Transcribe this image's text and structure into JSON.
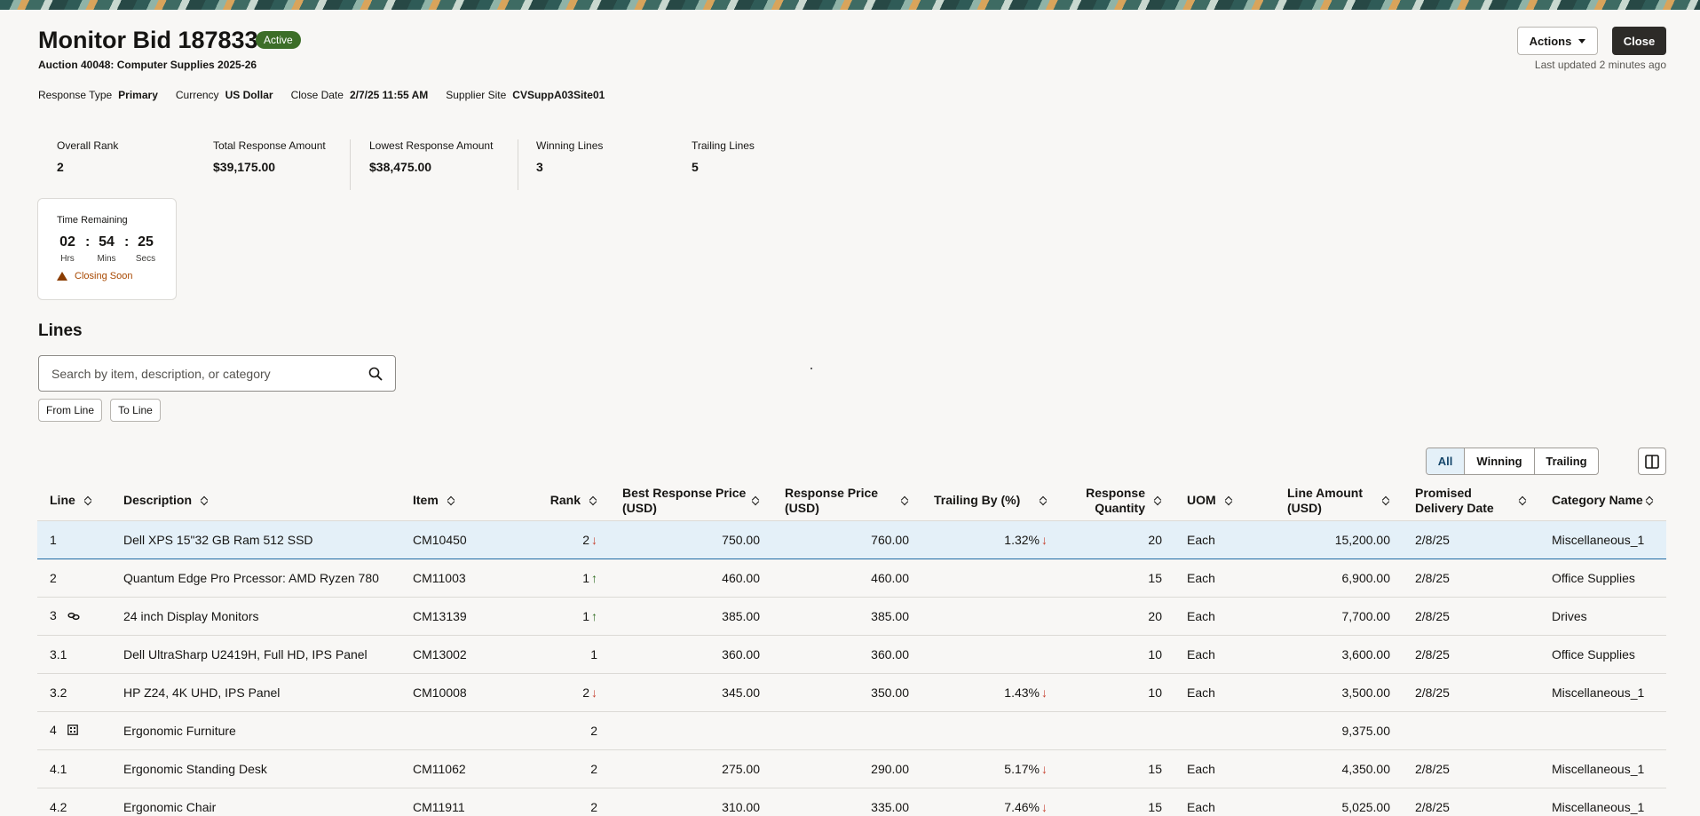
{
  "header": {
    "title": "Monitor Bid 187833",
    "status": "Active",
    "subtitle": "Auction 40048: Computer Supplies 2025-26",
    "actions_label": "Actions",
    "close_label": "Close",
    "last_updated": "Last updated 2 minutes ago"
  },
  "meta": [
    {
      "label": "Response Type",
      "value": "Primary"
    },
    {
      "label": "Currency",
      "value": "US Dollar"
    },
    {
      "label": "Close Date",
      "value": "2/7/25 11:55 AM"
    },
    {
      "label": "Supplier Site",
      "value": "CVSuppA03Site01"
    }
  ],
  "stats": {
    "overall_rank": {
      "label": "Overall Rank",
      "value": "2"
    },
    "total_response": {
      "label": "Total Response Amount",
      "value": "$39,175.00"
    },
    "lowest_response": {
      "label": "Lowest Response Amount",
      "value": "$38,475.00"
    },
    "winning_lines": {
      "label": "Winning Lines",
      "value": "3"
    },
    "trailing_lines": {
      "label": "Trailing Lines",
      "value": "5"
    }
  },
  "timer": {
    "title": "Time Remaining",
    "hrs": "02",
    "mins": "54",
    "secs": "25",
    "hrs_label": "Hrs",
    "mins_label": "Mins",
    "secs_label": "Secs",
    "warning": "Closing Soon",
    "warning_color": "#a84800"
  },
  "lines": {
    "heading": "Lines",
    "search_placeholder": "Search by item, description, or category",
    "from_line": "From Line",
    "to_line": "To Line",
    "filters": [
      "All",
      "Winning",
      "Trailing"
    ],
    "selected_filter": "All",
    "columns": {
      "line": "Line",
      "description": "Description",
      "item": "Item",
      "rank": "Rank",
      "best_price": "Best Response Price (USD)",
      "response_price": "Response Price (USD)",
      "trailing_by": "Trailing By (%)",
      "quantity": "Response Quantity",
      "uom": "UOM",
      "line_amount": "Line Amount (USD)",
      "delivery": "Promised Delivery Date",
      "category": "Category Name"
    },
    "rows": [
      {
        "line": "1",
        "icon": "",
        "description": "Dell XPS 15\"32 GB Ram 512 SSD",
        "item": "CM10450",
        "rank": "2",
        "trend": "down",
        "best": "750.00",
        "price": "760.00",
        "trailing": "1.32%",
        "qty": "20",
        "uom": "Each",
        "amount": "15,200.00",
        "date": "2/8/25",
        "category": "Miscellaneous_1",
        "selected": true
      },
      {
        "line": "2",
        "icon": "",
        "description": "Quantum Edge Pro Prcessor: AMD Ryzen 780",
        "item": "CM11003",
        "rank": "1",
        "trend": "up",
        "best": "460.00",
        "price": "460.00",
        "trailing": "",
        "qty": "15",
        "uom": "Each",
        "amount": "6,900.00",
        "date": "2/8/25",
        "category": "Office Supplies"
      },
      {
        "line": "3",
        "icon": "link-icon",
        "description": "24 inch Display Monitors",
        "item": "CM13139",
        "rank": "1",
        "trend": "up",
        "best": "385.00",
        "price": "385.00",
        "trailing": "",
        "qty": "20",
        "uom": "Each",
        "amount": "7,700.00",
        "date": "2/8/25",
        "category": "Drives"
      },
      {
        "line": "3.1",
        "icon": "",
        "description": "Dell UltraSharp U2419H, Full HD, IPS Panel",
        "item": "CM13002",
        "rank": "1",
        "trend": "",
        "best": "360.00",
        "price": "360.00",
        "trailing": "",
        "qty": "10",
        "uom": "Each",
        "amount": "3,600.00",
        "date": "2/8/25",
        "category": "Office Supplies"
      },
      {
        "line": "3.2",
        "icon": "",
        "description": "HP Z24, 4K UHD, IPS Panel",
        "item": "CM10008",
        "rank": "2",
        "trend": "down",
        "best": "345.00",
        "price": "350.00",
        "trailing": "1.43%",
        "qty": "10",
        "uom": "Each",
        "amount": "3,500.00",
        "date": "2/8/25",
        "category": "Miscellaneous_1"
      },
      {
        "line": "4",
        "icon": "group-icon",
        "description": "Ergonomic Furniture",
        "item": "",
        "rank": "2",
        "trend": "",
        "best": "",
        "price": "",
        "trailing": "",
        "qty": "",
        "uom": "",
        "amount": "9,375.00",
        "date": "",
        "category": ""
      },
      {
        "line": "4.1",
        "icon": "",
        "description": "Ergonomic Standing Desk",
        "item": "CM11062",
        "rank": "2",
        "trend": "",
        "best": "275.00",
        "price": "290.00",
        "trailing": "5.17%",
        "qty": "15",
        "uom": "Each",
        "amount": "4,350.00",
        "date": "2/8/25",
        "category": "Miscellaneous_1"
      },
      {
        "line": "4.2",
        "icon": "",
        "description": "Ergonomic Chair",
        "item": "CM11911",
        "rank": "2",
        "trend": "",
        "best": "310.00",
        "price": "335.00",
        "trailing": "7.46%",
        "qty": "15",
        "uom": "Each",
        "amount": "5,025.00",
        "date": "2/8/25",
        "category": "Miscellaneous_1"
      }
    ]
  },
  "colors": {
    "active_badge": "#3c6e28",
    "up_arrow": "#2e6b1f",
    "down_arrow": "#c74634",
    "selected_row": "#e4f0f8"
  }
}
